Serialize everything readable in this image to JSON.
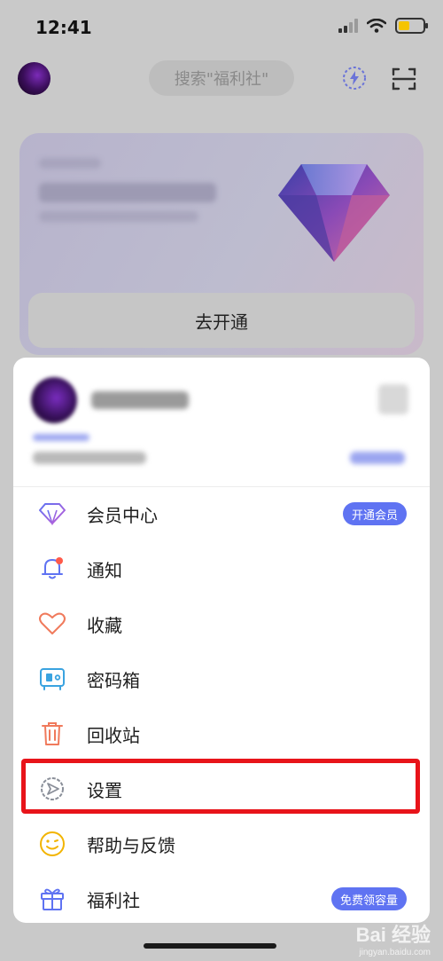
{
  "status_bar": {
    "time": "12:41"
  },
  "header": {
    "search_placeholder": "搜索\"福利社\""
  },
  "promo": {
    "button_label": "去开通"
  },
  "menu": {
    "items": [
      {
        "label": "会员中心",
        "badge": "开通会员",
        "icon": "diamond-icon"
      },
      {
        "label": "通知",
        "icon": "bell-icon"
      },
      {
        "label": "收藏",
        "icon": "heart-icon"
      },
      {
        "label": "密码箱",
        "icon": "safe-icon"
      },
      {
        "label": "回收站",
        "icon": "trash-icon"
      },
      {
        "label": "设置",
        "icon": "gear-icon"
      },
      {
        "label": "帮助与反馈",
        "icon": "smile-icon"
      },
      {
        "label": "福利社",
        "badge": "免费领容量",
        "icon": "gift-icon"
      }
    ]
  },
  "watermark": {
    "logo": "Bai 经验",
    "url": "jingyan.baidu.com"
  },
  "colors": {
    "accent": "#5f73f2",
    "highlight": "#e8141a",
    "battery": "#f5c400"
  }
}
